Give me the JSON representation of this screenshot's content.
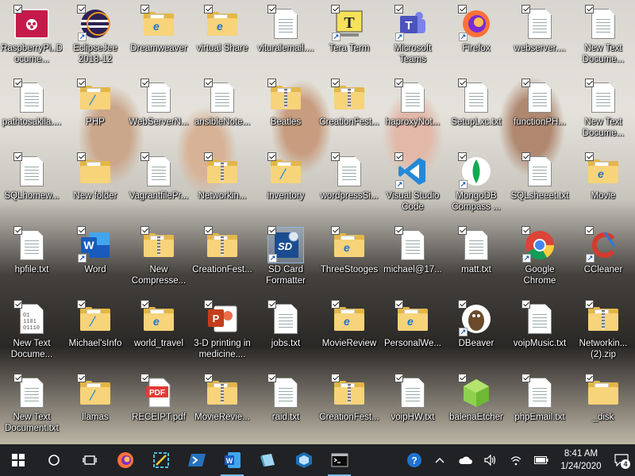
{
  "desktop": {
    "icons": [
      {
        "label": "RaspberryPi..Docume...",
        "type": "raspberry",
        "shortcut": false,
        "selected": false
      },
      {
        "label": "EclipseJee 2018-12",
        "type": "eclipse",
        "shortcut": true,
        "selected": false
      },
      {
        "label": "Dreamweaver",
        "type": "folder-edge",
        "shortcut": false,
        "selected": false
      },
      {
        "label": "virtual Share",
        "type": "folder-edge",
        "shortcut": false,
        "selected": false
      },
      {
        "label": "vituralemail....",
        "type": "doc",
        "shortcut": false,
        "selected": false
      },
      {
        "label": "Tera Term",
        "type": "teraterm",
        "shortcut": true,
        "selected": false
      },
      {
        "label": "Microsoft Teams",
        "type": "teams",
        "shortcut": true,
        "selected": false
      },
      {
        "label": "Firefox",
        "type": "firefox",
        "shortcut": true,
        "selected": false
      },
      {
        "label": "webserver....",
        "type": "doc",
        "shortcut": false,
        "selected": false
      },
      {
        "label": "New Text Docume...",
        "type": "doc",
        "shortcut": false,
        "selected": false
      },
      {
        "label": "pathtosakila....",
        "type": "doc",
        "shortcut": false,
        "selected": false
      },
      {
        "label": "PHP",
        "type": "folder-vscode",
        "shortcut": false,
        "selected": false
      },
      {
        "label": "WebServerN...",
        "type": "doc",
        "shortcut": false,
        "selected": false
      },
      {
        "label": "ansibleNote...",
        "type": "doc",
        "shortcut": false,
        "selected": false
      },
      {
        "label": "Beatles",
        "type": "folder-zip",
        "shortcut": false,
        "selected": false
      },
      {
        "label": "CreationFest...",
        "type": "folder-zip",
        "shortcut": false,
        "selected": false
      },
      {
        "label": "haproxyNot...",
        "type": "doc",
        "shortcut": false,
        "selected": false
      },
      {
        "label": "SetupLxc.txt",
        "type": "doc",
        "shortcut": false,
        "selected": false
      },
      {
        "label": "functionPH...",
        "type": "doc",
        "shortcut": false,
        "selected": false
      },
      {
        "label": "New Text Docume...",
        "type": "doc",
        "shortcut": false,
        "selected": false
      },
      {
        "label": "SQLhomew...",
        "type": "doc",
        "shortcut": false,
        "selected": false
      },
      {
        "label": "New folder",
        "type": "folder",
        "shortcut": false,
        "selected": false
      },
      {
        "label": "VagrantfilePr...",
        "type": "doc",
        "shortcut": false,
        "selected": false
      },
      {
        "label": "Networkin...",
        "type": "folder-zip",
        "shortcut": false,
        "selected": false
      },
      {
        "label": "inventory",
        "type": "folder-vscode",
        "shortcut": false,
        "selected": false
      },
      {
        "label": "wordpressSi...",
        "type": "doc",
        "shortcut": false,
        "selected": false
      },
      {
        "label": "Visual Studio Code",
        "type": "vscode",
        "shortcut": true,
        "selected": false
      },
      {
        "label": "MongoDB Compass ...",
        "type": "mongodb",
        "shortcut": true,
        "selected": false
      },
      {
        "label": "SQLsheeet.txt",
        "type": "doc",
        "shortcut": false,
        "selected": false
      },
      {
        "label": "Movie",
        "type": "folder-edge",
        "shortcut": false,
        "selected": false
      },
      {
        "label": "hpfile.txt",
        "type": "doc",
        "shortcut": false,
        "selected": false
      },
      {
        "label": "Word",
        "type": "word",
        "shortcut": true,
        "selected": false
      },
      {
        "label": "New Compresse...",
        "type": "folder-zip",
        "shortcut": false,
        "selected": false
      },
      {
        "label": "CreationFest...",
        "type": "folder-zip",
        "shortcut": false,
        "selected": false
      },
      {
        "label": "SD Card Formatter",
        "type": "sdcard",
        "shortcut": true,
        "selected": true
      },
      {
        "label": "ThreeStooges",
        "type": "folder-edge",
        "shortcut": false,
        "selected": false
      },
      {
        "label": "michael@17...",
        "type": "doc",
        "shortcut": false,
        "selected": false
      },
      {
        "label": "matt.txt",
        "type": "doc",
        "shortcut": false,
        "selected": false
      },
      {
        "label": "Google Chrome",
        "type": "chrome",
        "shortcut": true,
        "selected": false
      },
      {
        "label": "CCleaner",
        "type": "ccleaner",
        "shortcut": true,
        "selected": false
      },
      {
        "label": "New Text Docume...",
        "type": "binary",
        "shortcut": false,
        "selected": false
      },
      {
        "label": "Michael'sInfo",
        "type": "folder-vscode",
        "shortcut": false,
        "selected": false
      },
      {
        "label": "world_travel",
        "type": "folder-edge",
        "shortcut": false,
        "selected": false
      },
      {
        "label": "3-D printing in medicine....",
        "type": "powerpoint",
        "shortcut": false,
        "selected": false
      },
      {
        "label": "jobs.txt",
        "type": "doc",
        "shortcut": false,
        "selected": false
      },
      {
        "label": "MovieReview",
        "type": "folder-edge",
        "shortcut": false,
        "selected": false
      },
      {
        "label": "PersonalWe...",
        "type": "folder-edge",
        "shortcut": false,
        "selected": false
      },
      {
        "label": "DBeaver",
        "type": "dbeaver",
        "shortcut": true,
        "selected": false
      },
      {
        "label": "voipMusic.txt",
        "type": "doc",
        "shortcut": false,
        "selected": false
      },
      {
        "label": "Networkin... (2).zip",
        "type": "folder-zip",
        "shortcut": false,
        "selected": false
      },
      {
        "label": "New Text Document.txt",
        "type": "doc",
        "shortcut": false,
        "selected": false
      },
      {
        "label": "llamas",
        "type": "folder-vscode",
        "shortcut": false,
        "selected": false
      },
      {
        "label": "RECEIPT.pdf",
        "type": "pdf",
        "shortcut": false,
        "selected": false
      },
      {
        "label": "MovieRevie...",
        "type": "folder-zip",
        "shortcut": false,
        "selected": false
      },
      {
        "label": "raid.txt",
        "type": "doc",
        "shortcut": false,
        "selected": false
      },
      {
        "label": "CreationFest...",
        "type": "folder-zip",
        "shortcut": false,
        "selected": false
      },
      {
        "label": "voipHW.txt",
        "type": "doc",
        "shortcut": false,
        "selected": false
      },
      {
        "label": "balenaEtcher",
        "type": "balena",
        "shortcut": false,
        "selected": false
      },
      {
        "label": "phpEmail.txt",
        "type": "doc",
        "shortcut": false,
        "selected": false
      },
      {
        "label": "_disk",
        "type": "folder",
        "shortcut": false,
        "selected": false
      }
    ]
  },
  "taskbar": {
    "start_icon": "windows-start-icon",
    "search_icon": "cortana-circle-icon",
    "taskview_icon": "task-view-icon",
    "pinned": [
      {
        "name": "firefox",
        "icon": "firefox-icon",
        "active": false
      },
      {
        "name": "snipping",
        "icon": "snip-tool-icon",
        "active": false
      },
      {
        "name": "powershell",
        "icon": "powershell-icon",
        "active": false
      },
      {
        "name": "word",
        "icon": "word-icon",
        "active": true
      },
      {
        "name": "files",
        "icon": "windows-explorer-icon",
        "active": false
      },
      {
        "name": "virtualbox",
        "icon": "virtualbox-icon",
        "active": false
      },
      {
        "name": "terminal",
        "icon": "terminal-icon",
        "active": true
      }
    ],
    "tray": {
      "overflow": "^",
      "time": "8:41 AM",
      "date": "1/24/2020",
      "notification_count": "4"
    },
    "colors": {
      "background": "#202225",
      "active_indicator": "#76b9ed"
    }
  }
}
